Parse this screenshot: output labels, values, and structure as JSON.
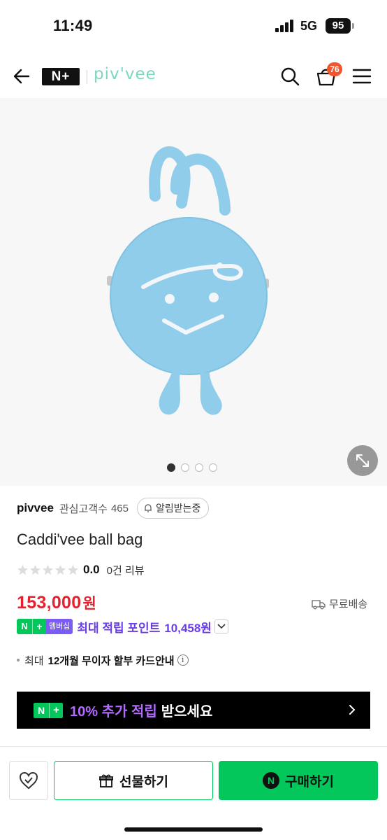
{
  "status_bar": {
    "time": "11:49",
    "network": "5G",
    "battery": "95"
  },
  "header": {
    "nplus_logo": "N+",
    "brand_logo": "piv'vee",
    "cart_count": "76",
    "icons": [
      "back-arrow-icon",
      "search-icon",
      "cart-icon",
      "menu-icon"
    ]
  },
  "gallery": {
    "image_count": 4,
    "active_index": 0
  },
  "seller": {
    "name": "pivvee",
    "follower_label": "관심고객수",
    "follower_count": "465",
    "notify_label": "알림받는중"
  },
  "product": {
    "title": "Caddi'vee ball bag",
    "rating": "0.0",
    "review_count": "0건 리뷰",
    "stars_filled": 0,
    "price": "153,000",
    "price_unit": "원",
    "shipping": "무료배송"
  },
  "points": {
    "badge_n": "N",
    "badge_plus": "+",
    "badge_membership": "멤버십",
    "text": "최대 적립 포인트",
    "value": "10,458원"
  },
  "installment": {
    "prefix": "최대",
    "strong": "12개월 무이자 할부 카드안내",
    "info": "i"
  },
  "promo": {
    "badge_n": "N",
    "badge_plus": "+",
    "highlight": "10% 추가 적립",
    "rest": "받으세요"
  },
  "bottom": {
    "gift_label": "선물하기",
    "buy_label": "구매하기",
    "buy_icon_letter": "N"
  },
  "colors": {
    "naver_green": "#03c75a",
    "price_red": "#e2232f",
    "points_purple": "#6a3de8",
    "brand_mint": "#7dd6c1",
    "badge_orange": "#f0552e",
    "bag_blue": "#8fcdea"
  }
}
